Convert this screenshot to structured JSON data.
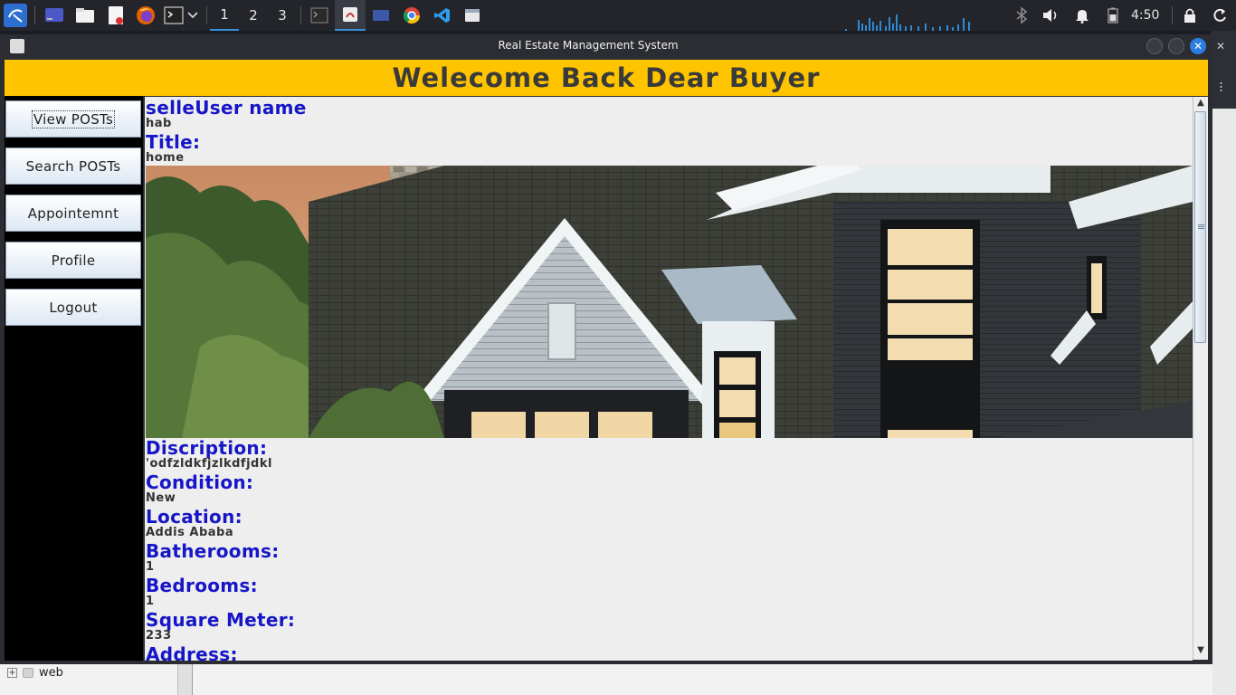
{
  "taskbar": {
    "workspaces": [
      "1",
      "2",
      "3"
    ],
    "active_workspace": "1",
    "clock": "4:50",
    "accent": "#3b8fd6"
  },
  "window": {
    "title": "Real Estate Management System",
    "close_glyph": "✕"
  },
  "banner": {
    "text": "Welecome Back Dear Buyer",
    "color": "#ffc400"
  },
  "sidebar": {
    "items": [
      {
        "label": "View POSTs"
      },
      {
        "label": "Search POSTs"
      },
      {
        "label": "Appointemnt"
      },
      {
        "label": "Profile"
      },
      {
        "label": "Logout"
      }
    ]
  },
  "post": {
    "seller_label": "selleUser name",
    "seller_value": "hab",
    "title_label": "Title:",
    "title_value": "home",
    "description_label": "Discription:",
    "description_value": "'odfzldkfjzlkdfjdkl",
    "condition_label": "Condition:",
    "condition_value": "New",
    "location_label": "Location:",
    "location_value": "Addis Ababa",
    "bathrooms_label": "Batherooms:",
    "bathrooms_value": "1",
    "bedrooms_label": "Bedrooms:",
    "bedrooms_value": "1",
    "square_meter_label": "Square Meter:",
    "square_meter_value": "233",
    "address_label": "Address:",
    "label_color": "#1616c8"
  },
  "background_app": {
    "tree_item": "web"
  }
}
